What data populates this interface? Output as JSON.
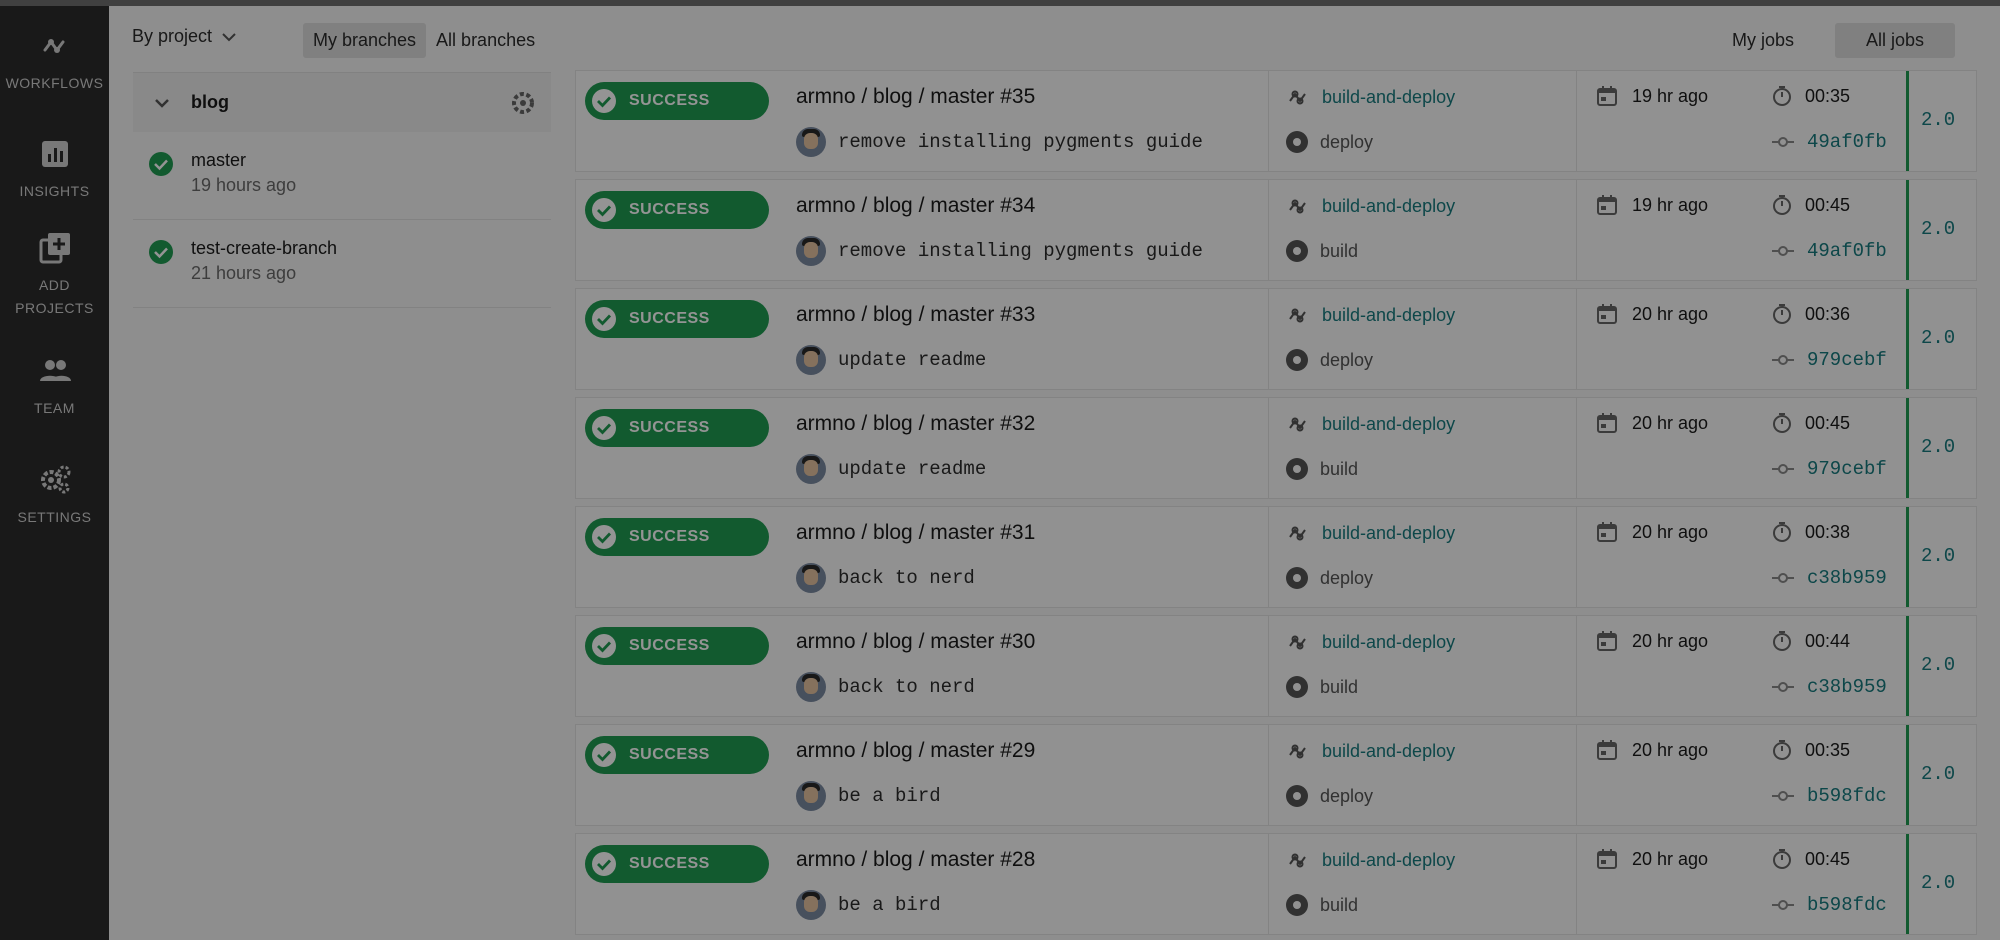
{
  "nav": {
    "items": [
      {
        "label": "WORKFLOWS",
        "icon": "workflows-icon"
      },
      {
        "label": "INSIGHTS",
        "icon": "insights-icon"
      },
      {
        "label": "ADD PROJECTS",
        "icon": "add-projects-icon"
      },
      {
        "label": "TEAM",
        "icon": "team-icon"
      },
      {
        "label": "SETTINGS",
        "icon": "settings-icon"
      }
    ]
  },
  "topbar": {
    "by_project": "By project",
    "my_branches": "My branches",
    "all_branches": "All branches",
    "my_jobs": "My jobs",
    "all_jobs": "All jobs"
  },
  "project": {
    "name": "blog",
    "branches": [
      {
        "name": "master",
        "time": "19 hours ago"
      },
      {
        "name": "test-create-branch",
        "time": "21 hours ago"
      }
    ]
  },
  "colors": {
    "success": "#1f9b52",
    "link": "#177a7e",
    "nav_bg": "#2b2b2b"
  },
  "runs": [
    {
      "status": "SUCCESS",
      "title": "armno / blog / master #35",
      "commit": "remove installing pygments guide",
      "workflow": "build-and-deploy",
      "job": "deploy",
      "when": "19 hr ago",
      "duration": "00:35",
      "sha": "49af0fb",
      "version": "2.0"
    },
    {
      "status": "SUCCESS",
      "title": "armno / blog / master #34",
      "commit": "remove installing pygments guide",
      "workflow": "build-and-deploy",
      "job": "build",
      "when": "19 hr ago",
      "duration": "00:45",
      "sha": "49af0fb",
      "version": "2.0"
    },
    {
      "status": "SUCCESS",
      "title": "armno / blog / master #33",
      "commit": "update readme",
      "workflow": "build-and-deploy",
      "job": "deploy",
      "when": "20 hr ago",
      "duration": "00:36",
      "sha": "979cebf",
      "version": "2.0"
    },
    {
      "status": "SUCCESS",
      "title": "armno / blog / master #32",
      "commit": "update readme",
      "workflow": "build-and-deploy",
      "job": "build",
      "when": "20 hr ago",
      "duration": "00:45",
      "sha": "979cebf",
      "version": "2.0"
    },
    {
      "status": "SUCCESS",
      "title": "armno / blog / master #31",
      "commit": "back to nerd",
      "workflow": "build-and-deploy",
      "job": "deploy",
      "when": "20 hr ago",
      "duration": "00:38",
      "sha": "c38b959",
      "version": "2.0"
    },
    {
      "status": "SUCCESS",
      "title": "armno / blog / master #30",
      "commit": "back to nerd",
      "workflow": "build-and-deploy",
      "job": "build",
      "when": "20 hr ago",
      "duration": "00:44",
      "sha": "c38b959",
      "version": "2.0"
    },
    {
      "status": "SUCCESS",
      "title": "armno / blog / master #29",
      "commit": "be a bird",
      "workflow": "build-and-deploy",
      "job": "deploy",
      "when": "20 hr ago",
      "duration": "00:35",
      "sha": "b598fdc",
      "version": "2.0"
    },
    {
      "status": "SUCCESS",
      "title": "armno / blog / master #28",
      "commit": "be a bird",
      "workflow": "build-and-deploy",
      "job": "build",
      "when": "20 hr ago",
      "duration": "00:45",
      "sha": "b598fdc",
      "version": "2.0"
    }
  ]
}
